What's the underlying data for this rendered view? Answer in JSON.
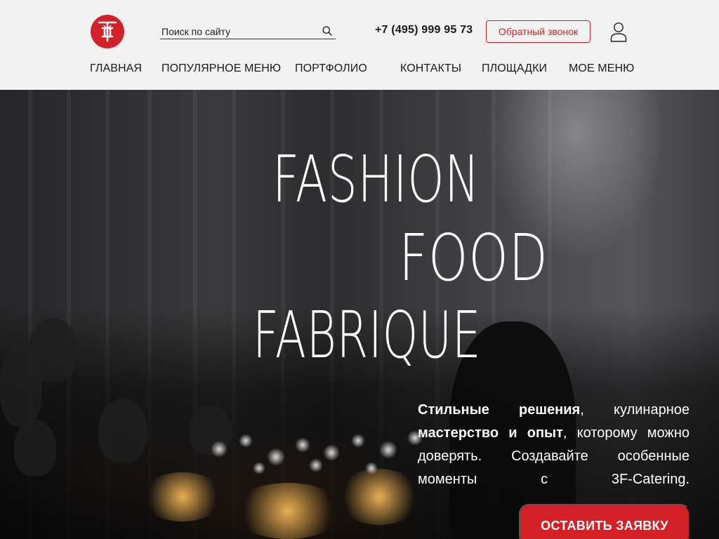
{
  "header": {
    "logo_alt": "3F Catering logo",
    "search": {
      "placeholder": "Поиск по сайту"
    },
    "phone": "+7 (495) 999 95 73",
    "callback_label": "Обратный звонок"
  },
  "nav": {
    "items": [
      {
        "label": "ГЛАВНАЯ"
      },
      {
        "label": "ПОПУЛЯРНОЕ МЕНЮ"
      },
      {
        "label": "ПОРТФОЛИО"
      },
      {
        "label": "КОНТАКТЫ"
      },
      {
        "label": "ПЛОЩАДКИ"
      },
      {
        "label": "МОЕ МЕНЮ"
      }
    ]
  },
  "hero": {
    "title_line1": "FASHION",
    "title_line2": "FOOD",
    "title_line3": "FABRIQUE",
    "tagline": {
      "bold1": "Стильные решения",
      "text1": ", кулинарное",
      "bold2": "мастерство и опыт",
      "text2": ", которому можно доверять. Создавайте особенные моменты с 3F-Catering."
    },
    "cta_label": "ОСТАВИТЬ ЗАЯВКУ"
  },
  "colors": {
    "accent": "#d42027",
    "header_bg": "#f2f2f2",
    "text": "#1a1a1a"
  },
  "icons": [
    "search-icon",
    "user-icon",
    "logo-icon"
  ]
}
